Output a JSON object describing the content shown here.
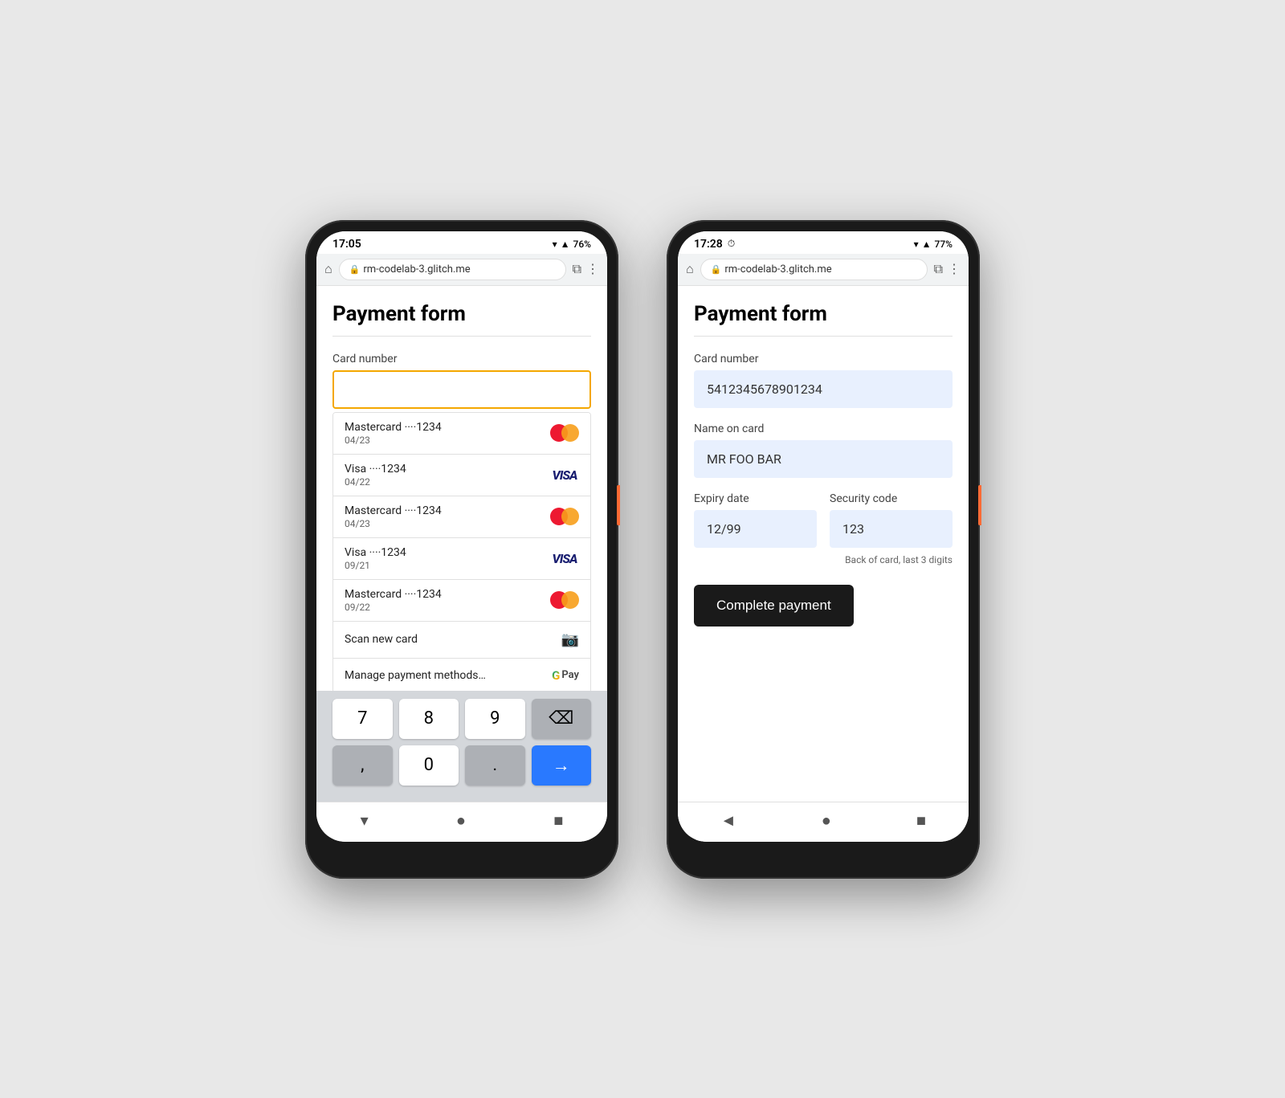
{
  "left_phone": {
    "status_bar": {
      "time": "17:05",
      "battery": "76%"
    },
    "browser": {
      "url": "rm-codelab-3.glitch.me"
    },
    "page": {
      "title": "Payment form"
    },
    "card_number_label": "Card number",
    "saved_cards": [
      {
        "type": "Mastercard",
        "dots": "····1234",
        "expiry": "04/23",
        "brand": "mastercard"
      },
      {
        "type": "Visa",
        "dots": "····1234",
        "expiry": "04/22",
        "brand": "visa"
      },
      {
        "type": "Mastercard",
        "dots": "····1234",
        "expiry": "04/23",
        "brand": "mastercard"
      },
      {
        "type": "Visa",
        "dots": "····1234",
        "expiry": "09/21",
        "brand": "visa"
      },
      {
        "type": "Mastercard",
        "dots": "····1234",
        "expiry": "09/22",
        "brand": "mastercard"
      }
    ],
    "scan_card": "Scan new card",
    "manage": "Manage payment methods…",
    "numpad": {
      "keys": [
        "7",
        "8",
        "9",
        "⌫",
        ",",
        "0",
        ".",
        "→"
      ]
    }
  },
  "right_phone": {
    "status_bar": {
      "time": "17:28",
      "battery": "77%"
    },
    "browser": {
      "url": "rm-codelab-3.glitch.me"
    },
    "page": {
      "title": "Payment form"
    },
    "card_number_label": "Card number",
    "card_number_value": "5412345678901234",
    "name_label": "Name on card",
    "name_value": "MR FOO BAR",
    "expiry_label": "Expiry date",
    "expiry_value": "12/99",
    "security_label": "Security code",
    "security_value": "123",
    "security_hint": "Back of card, last 3 digits",
    "complete_button": "Complete payment"
  }
}
